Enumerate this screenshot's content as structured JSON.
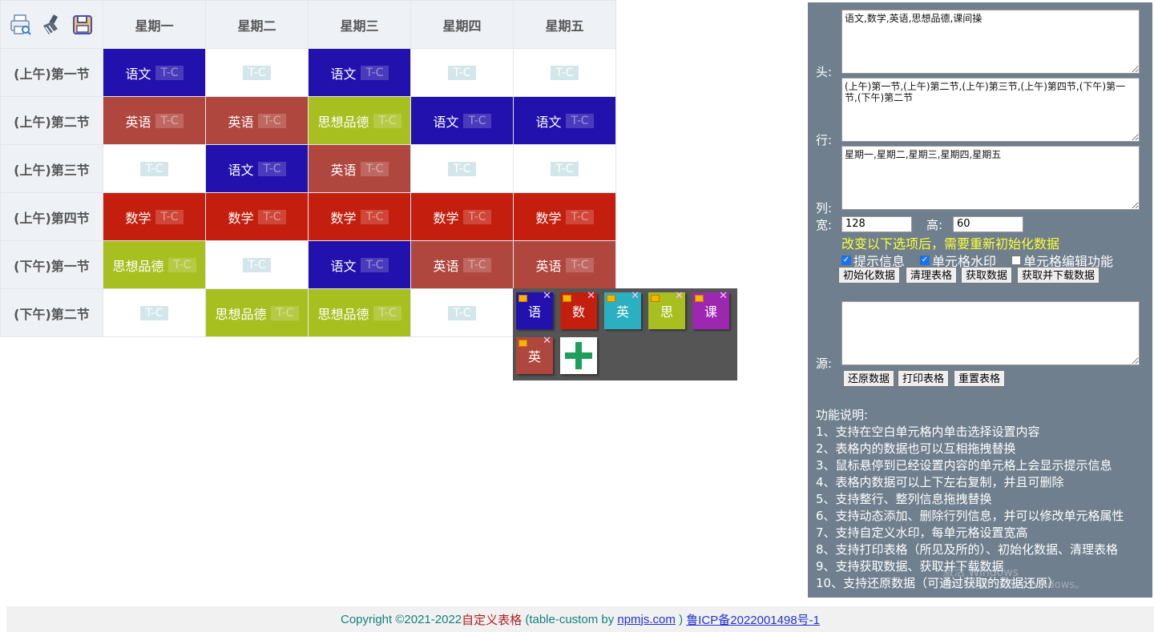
{
  "table": {
    "toolbar_icons": [
      "print-preview-icon",
      "clear-broom-icon",
      "save-disk-icon"
    ],
    "columns": [
      "星期一",
      "星期二",
      "星期三",
      "星期四",
      "星期五"
    ],
    "rows": [
      {
        "label": "(上午)第一节",
        "cells": [
          {
            "subject": "语文",
            "color": "#2311ad"
          },
          {
            "subject": "",
            "color": ""
          },
          {
            "subject": "语文",
            "color": "#2311ad"
          },
          {
            "subject": "",
            "color": ""
          },
          {
            "subject": "",
            "color": ""
          }
        ]
      },
      {
        "label": "(上午)第二节",
        "cells": [
          {
            "subject": "英语",
            "color": "#b0473f"
          },
          {
            "subject": "英语",
            "color": "#b0473f"
          },
          {
            "subject": "思想品德",
            "color": "#a8bf20"
          },
          {
            "subject": "语文",
            "color": "#2311ad"
          },
          {
            "subject": "语文",
            "color": "#2311ad"
          }
        ]
      },
      {
        "label": "(上午)第三节",
        "cells": [
          {
            "subject": "",
            "color": ""
          },
          {
            "subject": "语文",
            "color": "#2311ad"
          },
          {
            "subject": "英语",
            "color": "#b0473f"
          },
          {
            "subject": "",
            "color": ""
          },
          {
            "subject": "",
            "color": ""
          }
        ]
      },
      {
        "label": "(上午)第四节",
        "cells": [
          {
            "subject": "数学",
            "color": "#c41f0e"
          },
          {
            "subject": "数学",
            "color": "#c41f0e"
          },
          {
            "subject": "数学",
            "color": "#c41f0e"
          },
          {
            "subject": "数学",
            "color": "#c41f0e"
          },
          {
            "subject": "数学",
            "color": "#c41f0e"
          }
        ]
      },
      {
        "label": "(下午)第一节",
        "cells": [
          {
            "subject": "思想品德",
            "color": "#a8bf20"
          },
          {
            "subject": "",
            "color": ""
          },
          {
            "subject": "语文",
            "color": "#2311ad"
          },
          {
            "subject": "英语",
            "color": "#b0473f"
          },
          {
            "subject": "英语",
            "color": "#b0473f"
          }
        ]
      },
      {
        "label": "(下午)第二节",
        "cells": [
          {
            "subject": "",
            "color": ""
          },
          {
            "subject": "思想品德",
            "color": "#a8bf20"
          },
          {
            "subject": "思想品德",
            "color": "#a8bf20"
          },
          {
            "subject": "",
            "color": ""
          },
          {
            "subject": "",
            "color": ""
          }
        ]
      }
    ],
    "watermark": "T-C"
  },
  "palette": {
    "chips": [
      {
        "label": "语",
        "color": "#2311ad"
      },
      {
        "label": "数",
        "color": "#c41f0e"
      },
      {
        "label": "英",
        "color": "#2ab0c0"
      },
      {
        "label": "思",
        "color": "#a8bf20"
      },
      {
        "label": "课",
        "color": "#9d27b0"
      },
      {
        "label": "英",
        "color": "#b0473f"
      }
    ],
    "delete_glyph": "✕",
    "add_color": "#1e9e5a"
  },
  "panel": {
    "head_label": "头:",
    "head_value": "语文,数学,英语,思想品德,课间操",
    "row_label": "行:",
    "row_value": "(上午)第一节,(上午)第二节,(上午)第三节,(上午)第四节,(下午)第一节,(下午)第二节",
    "col_label": "列:",
    "col_value": "星期一,星期二,星期三,星期四,星期五",
    "width_label": "宽:",
    "width_value": "128",
    "height_label": "高:",
    "height_value": "60",
    "warning": "改变以下选项后，需要重新初始化数据",
    "options": [
      {
        "label": "提示信息",
        "checked": true
      },
      {
        "label": "单元格水印",
        "checked": true
      },
      {
        "label": "单元格编辑功能",
        "checked": false
      }
    ],
    "buttons": [
      "初始化数据",
      "清理表格",
      "获取数据",
      "获取并下载数据"
    ],
    "source_label": "源:",
    "source_value": "",
    "source_buttons": [
      "还原数据",
      "打印表格",
      "重置表格"
    ],
    "help_title": "功能说明:",
    "help_items": [
      "1、支持在空白单元格内单击选择设置内容",
      "2、表格内的数据也可以互相拖拽替换",
      "3、鼠标悬停到已经设置内容的单元格上会显示提示信息",
      "4、表格内数据可以上下左右复制，并且可删除",
      "5、支持整行、整列信息拖拽替换",
      "6、支持动态添加、删除行列信息，并可以修改单元格属性",
      "7、支持自定义水印，每单元格设置宽高",
      "8、支持打印表格（所见及所的）、初始化数据、清理表格",
      "9、支持获取数据、获取并下载数据",
      "10、支持还原数据（可通过获取的数据还原）"
    ],
    "os_watermark_line1": "激活 Windows",
    "os_watermark_line2": "转到\"设置\"以激活 Windows。"
  },
  "footer": {
    "copyright": "Copyright ©2021-2022 ",
    "brand": "自定义表格",
    "pkg_prefix": " (table-custom by ",
    "link": "npmjs.com",
    "pkg_suffix": " ) ",
    "icp": "鲁ICP备2022001498号-1"
  }
}
